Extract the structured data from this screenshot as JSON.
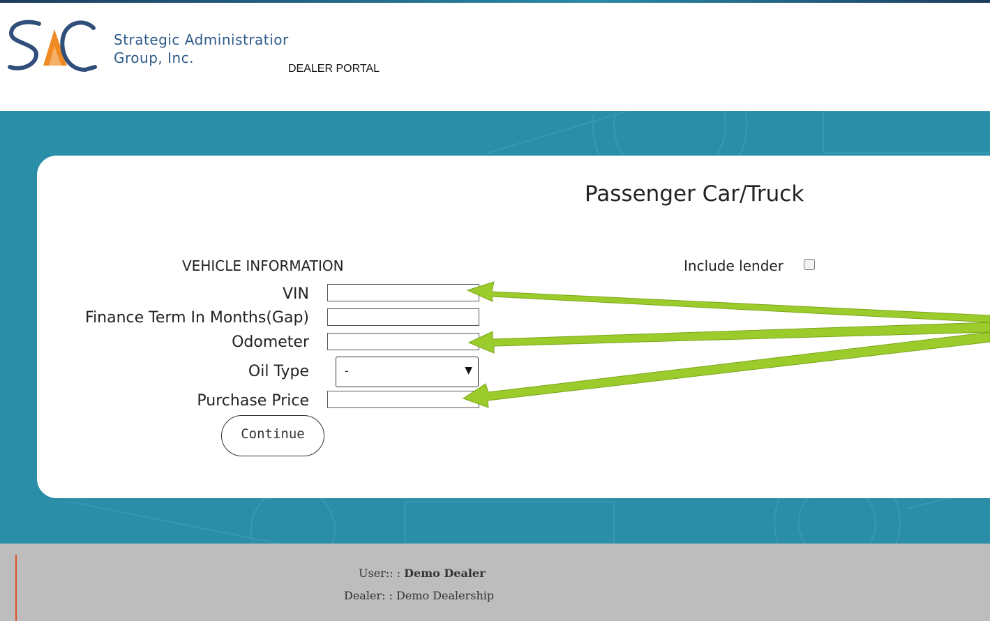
{
  "header": {
    "company_line1": "Strategic Administratior",
    "company_line2": "Group, Inc.",
    "portal_label": "DEALER PORTAL",
    "logo_icon": "sag-logo-icon"
  },
  "form": {
    "title": "Passenger Car/Truck",
    "section_label": "VEHICLE INFORMATION",
    "vin_label": "VIN",
    "vin_value": "",
    "finance_term_label": "Finance Term In Months(Gap)",
    "finance_term_value": "",
    "odometer_label": "Odometer",
    "odometer_value": "",
    "oil_type_label": "Oil Type",
    "oil_type_selected": "-",
    "purchase_price_label": "Purchase Price",
    "purchase_price_value": "",
    "continue_label": "Continue",
    "include_lender_label": "Include lender",
    "include_lender_checked": false
  },
  "annotations": {
    "arrow_color": "#9ccc2c"
  },
  "footer": {
    "user_label": "User:: :",
    "user_value": "Demo Dealer",
    "dealer_label": "Dealer: :",
    "dealer_value": "Demo Dealership"
  },
  "colors": {
    "hero_bg": "#2b8ea8",
    "footer_bg": "#bdbdbd",
    "brand_blue": "#2f5a8a",
    "brand_orange": "#f08a24",
    "footer_accent": "#e0502a"
  }
}
